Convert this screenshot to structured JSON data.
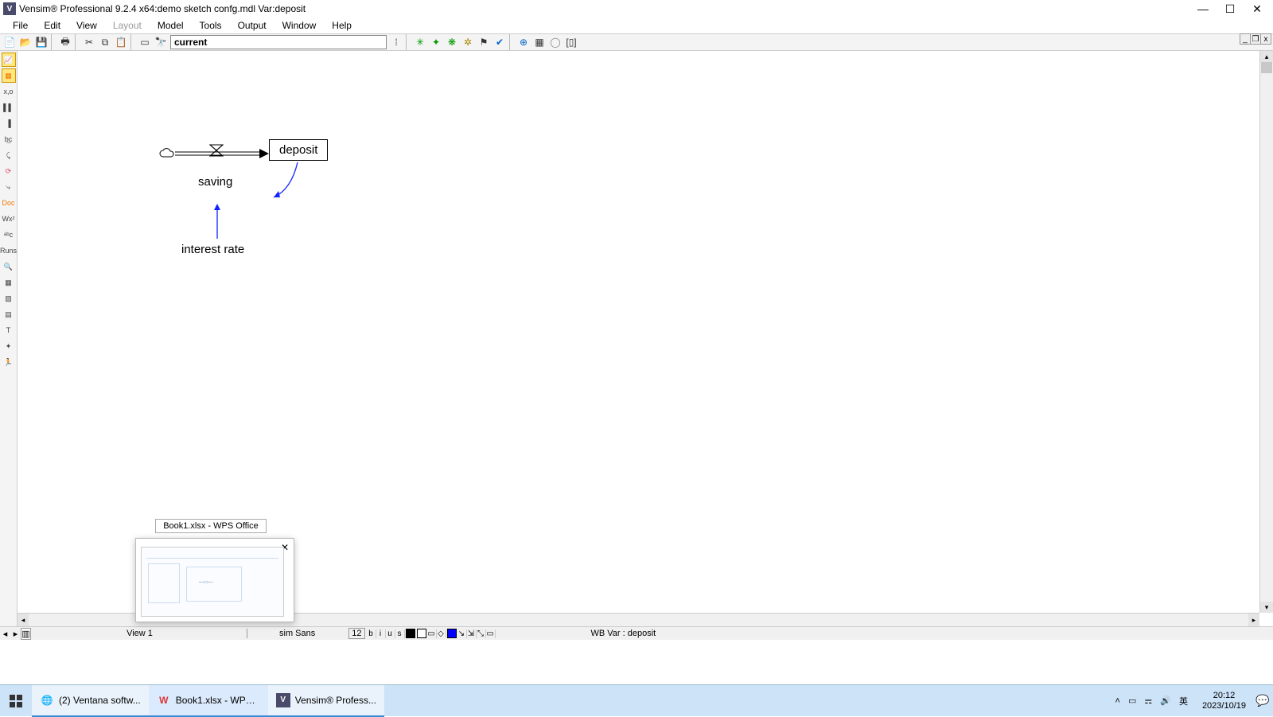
{
  "title": "Vensim® Professional 9.2.4 x64:demo sketch confg.mdl Var:deposit",
  "menu": {
    "file": "File",
    "edit": "Edit",
    "view": "View",
    "layout": "Layout",
    "model": "Model",
    "tools": "Tools",
    "output": "Output",
    "window": "Window",
    "help": "Help"
  },
  "combo_value": "current",
  "diagram": {
    "deposit": "deposit",
    "saving": "saving",
    "interest_rate": "interest rate"
  },
  "viewbar": {
    "view_name": "View 1",
    "font_name": "sim Sans",
    "font_size": "12",
    "b": "b",
    "i": "i",
    "u": "u",
    "s": "s",
    "wb_var": "WB Var : deposit"
  },
  "preview": {
    "title": "Book1.xlsx - WPS Office"
  },
  "taskbar": {
    "t1": "(2) Ventana softw...",
    "t2": "Book1.xlsx - WPS...",
    "t3": "Vensim® Profess...",
    "ime": "英",
    "time": "20:12",
    "date": "2023/10/19"
  }
}
